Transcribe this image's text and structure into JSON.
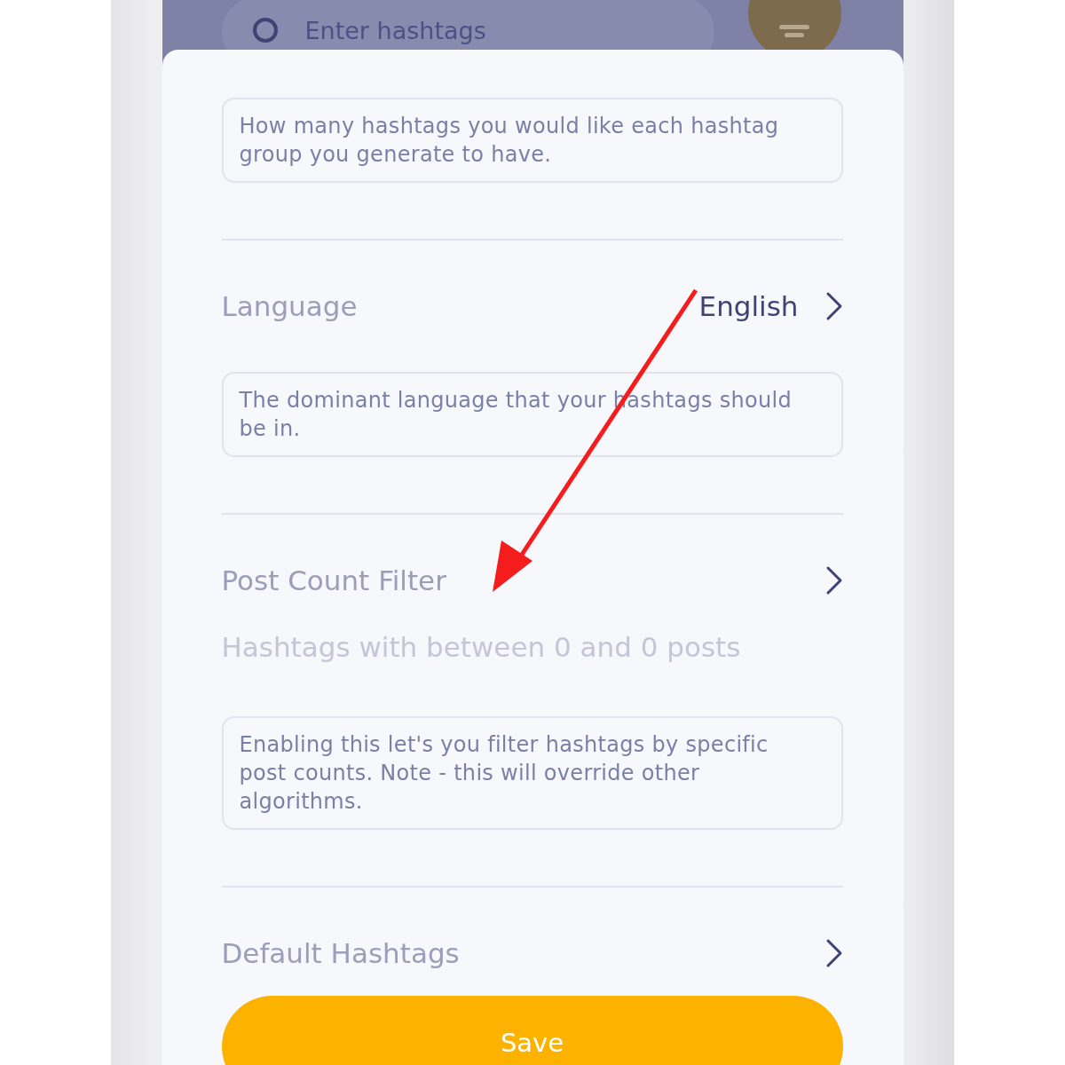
{
  "header": {
    "search": {
      "placeholder": "Enter hashtags"
    }
  },
  "sections": [
    {
      "description": "How many hashtags you would like each hashtag group you generate to have."
    },
    {
      "label": "Language",
      "value": "English",
      "description": "The dominant language that your hashtags should be in."
    },
    {
      "label": "Post Count Filter",
      "subtitle": "Hashtags with between 0 and 0 posts",
      "description": "Enabling this let's you filter hashtags by specific post counts. Note - this will override other algorithms."
    },
    {
      "label": "Default Hashtags"
    }
  ],
  "save_button": "Save"
}
